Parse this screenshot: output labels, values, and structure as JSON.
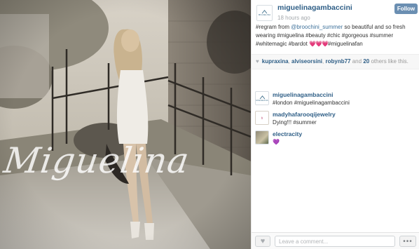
{
  "photo": {
    "overlay_text": "Miguelina"
  },
  "post": {
    "username": "miguelinagambaccini",
    "time": "18 hours ago",
    "follow_label": "Follow",
    "avatar_brand": "MIGUELINA",
    "caption": {
      "prefix": "#regram from ",
      "mention": "@broochini_summer",
      "middle": " so beautiful and so fresh wearing #miguelina #beauty #chic #gorgeous #summer #whitemagic #bardot ",
      "hearts": "💗💗💗",
      "suffix": "#miguelinafan"
    }
  },
  "likes": {
    "users": [
      "kupraxina",
      "alviseorsini",
      "robynb77"
    ],
    "and": "and",
    "count": "20",
    "suffix": "others like this."
  },
  "comments": [
    {
      "user": "miguelinagambaccini",
      "text": "#london #miguelinagambaccini",
      "avatar": "miguelina-logo"
    },
    {
      "user": "madyhafarooqijewelry",
      "text": "Dying!!! #summer",
      "avatar": "jewelry-logo"
    },
    {
      "user": "electracity",
      "text": "💜",
      "avatar": "photo"
    }
  ],
  "footer": {
    "comment_placeholder": "Leave a comment...",
    "like_icon": "heart-icon",
    "more_label": "•••"
  },
  "colors": {
    "link_blue": "#3f729b",
    "username_blue": "#2e5e86",
    "follow_button": "#6b8fb2"
  }
}
